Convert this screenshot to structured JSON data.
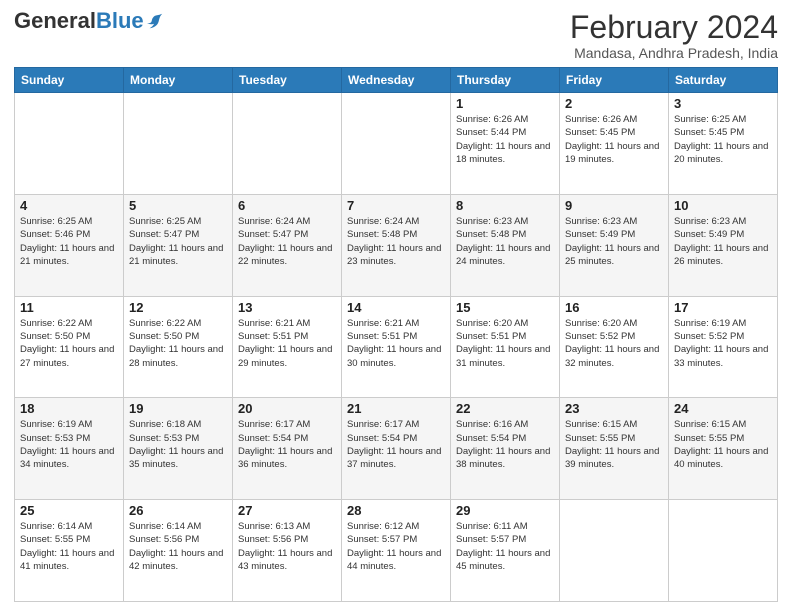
{
  "logo": {
    "general": "General",
    "blue": "Blue"
  },
  "title": "February 2024",
  "subtitle": "Mandasa, Andhra Pradesh, India",
  "days_of_week": [
    "Sunday",
    "Monday",
    "Tuesday",
    "Wednesday",
    "Thursday",
    "Friday",
    "Saturday"
  ],
  "weeks": [
    [
      {
        "day": "",
        "info": ""
      },
      {
        "day": "",
        "info": ""
      },
      {
        "day": "",
        "info": ""
      },
      {
        "day": "",
        "info": ""
      },
      {
        "day": "1",
        "info": "Sunrise: 6:26 AM\nSunset: 5:44 PM\nDaylight: 11 hours and 18 minutes."
      },
      {
        "day": "2",
        "info": "Sunrise: 6:26 AM\nSunset: 5:45 PM\nDaylight: 11 hours and 19 minutes."
      },
      {
        "day": "3",
        "info": "Sunrise: 6:25 AM\nSunset: 5:45 PM\nDaylight: 11 hours and 20 minutes."
      }
    ],
    [
      {
        "day": "4",
        "info": "Sunrise: 6:25 AM\nSunset: 5:46 PM\nDaylight: 11 hours and 21 minutes."
      },
      {
        "day": "5",
        "info": "Sunrise: 6:25 AM\nSunset: 5:47 PM\nDaylight: 11 hours and 21 minutes."
      },
      {
        "day": "6",
        "info": "Sunrise: 6:24 AM\nSunset: 5:47 PM\nDaylight: 11 hours and 22 minutes."
      },
      {
        "day": "7",
        "info": "Sunrise: 6:24 AM\nSunset: 5:48 PM\nDaylight: 11 hours and 23 minutes."
      },
      {
        "day": "8",
        "info": "Sunrise: 6:23 AM\nSunset: 5:48 PM\nDaylight: 11 hours and 24 minutes."
      },
      {
        "day": "9",
        "info": "Sunrise: 6:23 AM\nSunset: 5:49 PM\nDaylight: 11 hours and 25 minutes."
      },
      {
        "day": "10",
        "info": "Sunrise: 6:23 AM\nSunset: 5:49 PM\nDaylight: 11 hours and 26 minutes."
      }
    ],
    [
      {
        "day": "11",
        "info": "Sunrise: 6:22 AM\nSunset: 5:50 PM\nDaylight: 11 hours and 27 minutes."
      },
      {
        "day": "12",
        "info": "Sunrise: 6:22 AM\nSunset: 5:50 PM\nDaylight: 11 hours and 28 minutes."
      },
      {
        "day": "13",
        "info": "Sunrise: 6:21 AM\nSunset: 5:51 PM\nDaylight: 11 hours and 29 minutes."
      },
      {
        "day": "14",
        "info": "Sunrise: 6:21 AM\nSunset: 5:51 PM\nDaylight: 11 hours and 30 minutes."
      },
      {
        "day": "15",
        "info": "Sunrise: 6:20 AM\nSunset: 5:51 PM\nDaylight: 11 hours and 31 minutes."
      },
      {
        "day": "16",
        "info": "Sunrise: 6:20 AM\nSunset: 5:52 PM\nDaylight: 11 hours and 32 minutes."
      },
      {
        "day": "17",
        "info": "Sunrise: 6:19 AM\nSunset: 5:52 PM\nDaylight: 11 hours and 33 minutes."
      }
    ],
    [
      {
        "day": "18",
        "info": "Sunrise: 6:19 AM\nSunset: 5:53 PM\nDaylight: 11 hours and 34 minutes."
      },
      {
        "day": "19",
        "info": "Sunrise: 6:18 AM\nSunset: 5:53 PM\nDaylight: 11 hours and 35 minutes."
      },
      {
        "day": "20",
        "info": "Sunrise: 6:17 AM\nSunset: 5:54 PM\nDaylight: 11 hours and 36 minutes."
      },
      {
        "day": "21",
        "info": "Sunrise: 6:17 AM\nSunset: 5:54 PM\nDaylight: 11 hours and 37 minutes."
      },
      {
        "day": "22",
        "info": "Sunrise: 6:16 AM\nSunset: 5:54 PM\nDaylight: 11 hours and 38 minutes."
      },
      {
        "day": "23",
        "info": "Sunrise: 6:15 AM\nSunset: 5:55 PM\nDaylight: 11 hours and 39 minutes."
      },
      {
        "day": "24",
        "info": "Sunrise: 6:15 AM\nSunset: 5:55 PM\nDaylight: 11 hours and 40 minutes."
      }
    ],
    [
      {
        "day": "25",
        "info": "Sunrise: 6:14 AM\nSunset: 5:55 PM\nDaylight: 11 hours and 41 minutes."
      },
      {
        "day": "26",
        "info": "Sunrise: 6:14 AM\nSunset: 5:56 PM\nDaylight: 11 hours and 42 minutes."
      },
      {
        "day": "27",
        "info": "Sunrise: 6:13 AM\nSunset: 5:56 PM\nDaylight: 11 hours and 43 minutes."
      },
      {
        "day": "28",
        "info": "Sunrise: 6:12 AM\nSunset: 5:57 PM\nDaylight: 11 hours and 44 minutes."
      },
      {
        "day": "29",
        "info": "Sunrise: 6:11 AM\nSunset: 5:57 PM\nDaylight: 11 hours and 45 minutes."
      },
      {
        "day": "",
        "info": ""
      },
      {
        "day": "",
        "info": ""
      }
    ]
  ]
}
